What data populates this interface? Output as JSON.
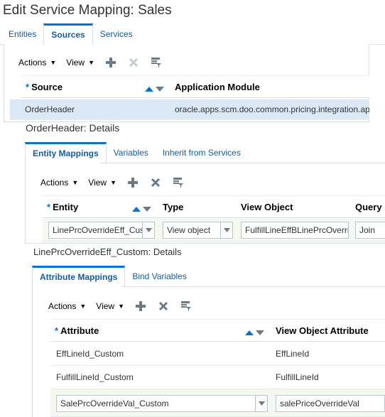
{
  "page": {
    "title": "Edit Service Mapping: Sales"
  },
  "main_tabs": [
    {
      "label": "Entities",
      "active": false
    },
    {
      "label": "Sources",
      "active": true
    },
    {
      "label": "Services",
      "active": false
    }
  ],
  "toolbar": {
    "actions_label": "Actions",
    "view_label": "View"
  },
  "sources_table": {
    "columns": {
      "source": "Source",
      "app_module": "Application Module"
    },
    "rows": [
      {
        "source": "OrderHeader",
        "app_module": "oracle.apps.scm.doo.common.pricing.integration.applicationModule"
      }
    ]
  },
  "source_details": {
    "title": "OrderHeader: Details",
    "tabs": [
      {
        "label": "Entity Mappings",
        "active": true
      },
      {
        "label": "Variables",
        "active": false
      },
      {
        "label": "Inherit from Services",
        "active": false
      }
    ],
    "columns": {
      "entity": "Entity",
      "type": "Type",
      "view_object": "View Object",
      "query": "Query"
    },
    "rows": [
      {
        "entity": "LinePrcOverrideEff_Custom",
        "type": "View object",
        "view_object": "FulfillLineEffBLinePrcOverride",
        "query": "Join"
      }
    ]
  },
  "entity_details": {
    "title": "LinePrcOverrideEff_Custom: Details",
    "tabs": [
      {
        "label": "Attribute Mappings",
        "active": true
      },
      {
        "label": "Bind Variables",
        "active": false
      }
    ],
    "columns": {
      "attribute": "Attribute",
      "vo_attribute": "View Object Attribute"
    },
    "rows": [
      {
        "attribute": "EffLineId_Custom",
        "vo_attribute": "EffLineId"
      },
      {
        "attribute": "FulfillLineId_Custom",
        "vo_attribute": "FulfillLineId"
      },
      {
        "attribute": "SalePrcOverrideVal_Custom",
        "vo_attribute": "salePriceOverrideVal"
      }
    ]
  },
  "colors": {
    "link": "#145c9e",
    "accent": "#0572ce",
    "selected_row": "#dbe8f5",
    "border": "#d6dfe6"
  }
}
